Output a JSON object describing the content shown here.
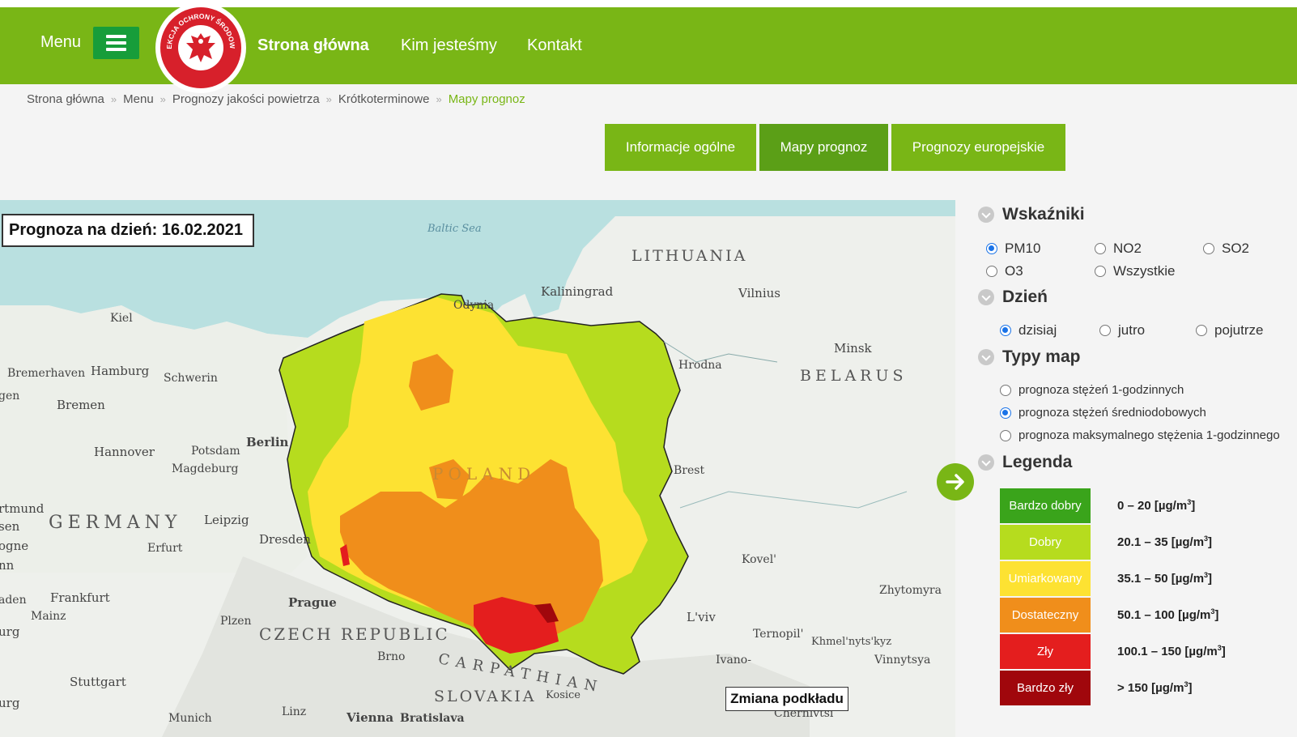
{
  "header": {
    "menu_label": "Menu",
    "logo_text": "INSPEKCJA OCHRONY ŚRODOWISKA",
    "nav": [
      "Strona główna",
      "Kim jesteśmy",
      "Kontakt"
    ]
  },
  "breadcrumbs": [
    "Strona główna",
    "Menu",
    "Prognozy jakości powietrza",
    "Krótkoterminowe",
    "Mapy prognoz"
  ],
  "breadcrumb_separator": "»",
  "tabs": [
    {
      "label": "Informacje ogólne",
      "active": false
    },
    {
      "label": "Mapy prognoz",
      "active": true
    },
    {
      "label": "Prognozy europejskie",
      "active": false
    }
  ],
  "map": {
    "forecast_label": "Prognoza na dzień: 16.02.2021",
    "basemap_button": "Zmiana podkładu",
    "labels": {
      "lithuania": "LITHUANIA",
      "belarus": "BELARUS",
      "germany": "GERMANY",
      "czech": "CZECH REPUBLIC",
      "slovakia": "SLOVAKIA",
      "poland": "POLAND",
      "carpathian": "CARPATHIAN",
      "baltic": "Baltic Sea",
      "kaliningrad": "Kaliningrad",
      "vilnius": "Vilnius",
      "minsk": "Minsk",
      "hrodna": "Hrodna",
      "brest": "Brest",
      "kovel": "Kovel'",
      "lviv": "L'viv",
      "zhytomyr": "Zhytomyra",
      "ternopil": "Ternopil'",
      "khmelnytskyi": "Khmel'nyts'kyz",
      "vinnytsya": "Vinnytsya",
      "ivano": "Ivano-",
      "berlin": "Berlin",
      "hamburg": "Hamburg",
      "bremen": "Bremen",
      "bremerhaven": "Bremerhaven",
      "kiel": "Kiel",
      "schwerin": "Schwerin",
      "hannover": "Hannover",
      "potsdam": "Potsdam",
      "magdeburg": "Magdeburg",
      "leipzig": "Leipzig",
      "dresden": "Dresden",
      "erfurt": "Erfurt",
      "frankfurt": "Frankfurt",
      "mainz": "Mainz",
      "prague": "Prague",
      "plzen": "Plzen",
      "brno": "Brno",
      "stuttgart": "Stuttgart",
      "munich": "Munich",
      "linz": "Linz",
      "vienna": "Vienna",
      "bratislava": "Bratislava",
      "kosice": "Kosice",
      "chernivtsi": "Chernivtsi",
      "odynia": "Odynia",
      "dortmund": "rtmund",
      "gen": "gen",
      "sen": "sen",
      "ogne": "ogne",
      "nn": "nn",
      "aden": "aden",
      "urg": "urg",
      "urg2": "urg"
    }
  },
  "panel": {
    "indicators_title": "Wskaźniki",
    "indicators": [
      {
        "label": "PM10",
        "checked": true
      },
      {
        "label": "NO2",
        "checked": false
      },
      {
        "label": "SO2",
        "checked": false
      },
      {
        "label": "O3",
        "checked": false
      },
      {
        "label": "Wszystkie",
        "checked": false
      }
    ],
    "day_title": "Dzień",
    "days": [
      {
        "label": "dzisiaj",
        "checked": true
      },
      {
        "label": "jutro",
        "checked": false
      },
      {
        "label": "pojutrze",
        "checked": false
      }
    ],
    "map_types_title": "Typy map",
    "map_types": [
      {
        "label": "prognoza stężeń 1-godzinnych",
        "checked": false
      },
      {
        "label": "prognoza stężeń średniodobowych",
        "checked": true
      },
      {
        "label": "prognoza maksymalnego stężenia 1-godzinnego",
        "checked": false
      }
    ],
    "legend_title": "Legenda",
    "legend": [
      {
        "label": "Bardzo dobry",
        "range": "0 – 20 [µg/m",
        "color": "#3aa41b",
        "text_color": "#ffffff"
      },
      {
        "label": "Dobry",
        "range": "20.1 – 35 [µg/m",
        "color": "#b6dc1e",
        "text_color": "#ffffff"
      },
      {
        "label": "Umiarkowany",
        "range": "35.1 – 50 [µg/m",
        "color": "#fde232",
        "text_color": "#ffffff"
      },
      {
        "label": "Dostateczny",
        "range": "50.1 – 100 [µg/m",
        "color": "#f08e1b",
        "text_color": "#ffffff"
      },
      {
        "label": "Zły",
        "range": "100.1 – 150 [µg/m",
        "color": "#e41e1e",
        "text_color": "#ffffff"
      },
      {
        "label": "Bardzo zły",
        "range": "> 150 [µg/m",
        "color": "#a0070c",
        "text_color": "#ffffff"
      }
    ],
    "unit_exponent": "3",
    "unit_close": "]"
  },
  "colors": {
    "brand_green": "#79b616",
    "active_tab": "#5b9f17",
    "menu_button": "#179d3a"
  }
}
